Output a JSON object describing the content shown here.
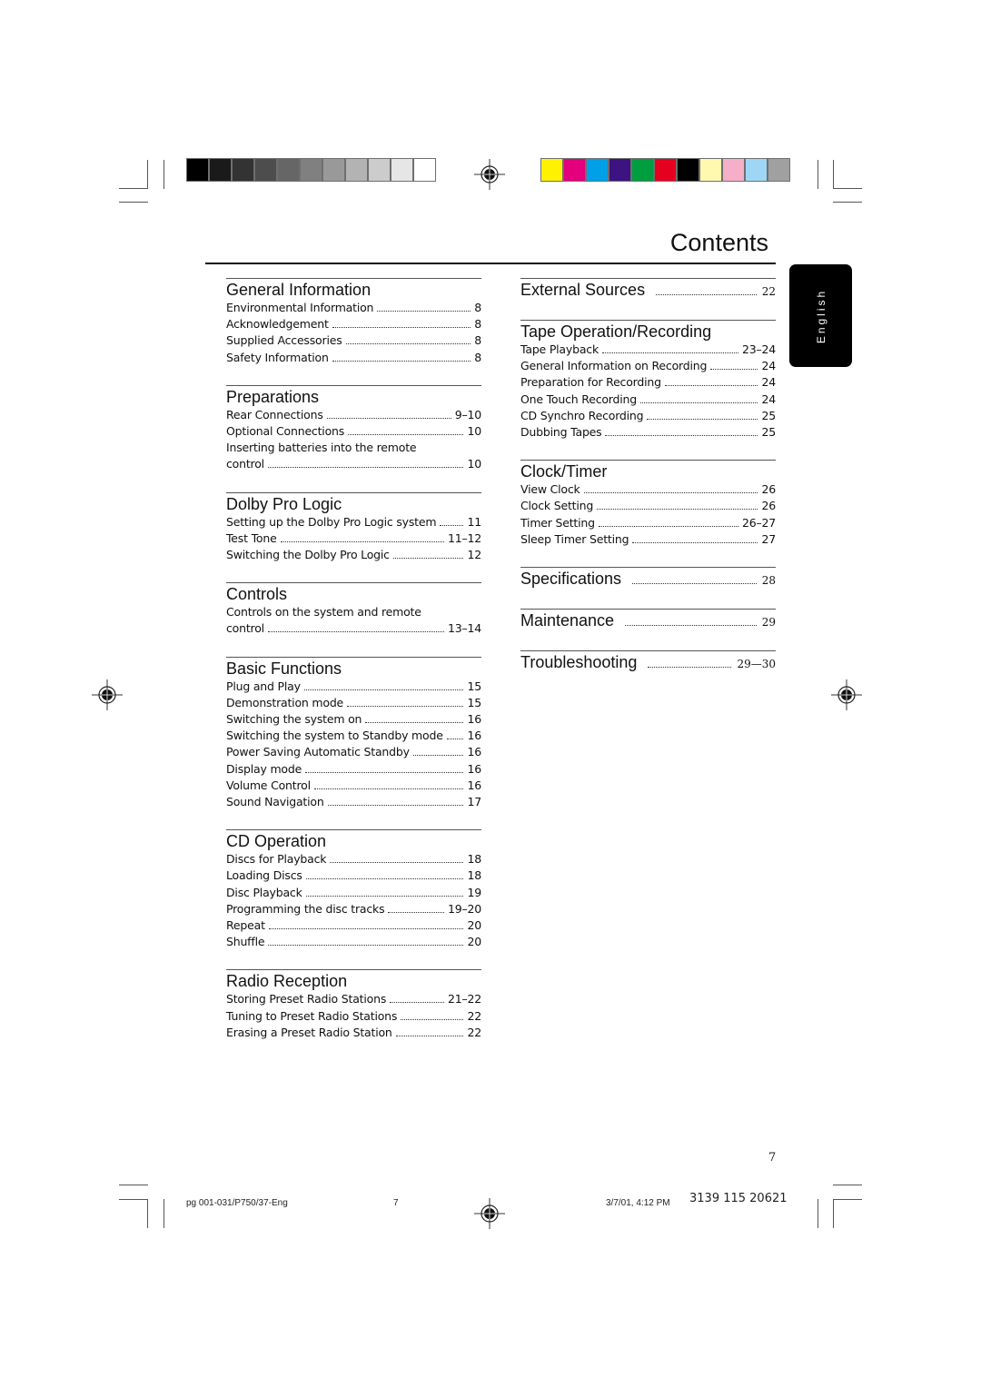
{
  "page": {
    "title": "Contents",
    "language_tab": "English",
    "page_number": "7"
  },
  "print_marks": {
    "grayscale_swatches": [
      "#000000",
      "#1a1a1a",
      "#333333",
      "#4d4d4d",
      "#666666",
      "#808080",
      "#999999",
      "#b3b3b3",
      "#cccccc",
      "#e6e6e6",
      "#ffffff"
    ],
    "color_swatches": [
      "#fff200",
      "#e4007c",
      "#00a0e9",
      "#3c1381",
      "#009e3f",
      "#e60020",
      "#000000",
      "#fff9b0",
      "#f5afc8",
      "#9fd6f6",
      "#a0a0a0"
    ]
  },
  "left_column": [
    {
      "heading": "General Information",
      "entries": [
        {
          "label": "Environmental Information",
          "page": "8"
        },
        {
          "label": "Acknowledgement",
          "page": "8"
        },
        {
          "label": "Supplied Accessories",
          "page": "8"
        },
        {
          "label": "Safety Information",
          "page": "8"
        }
      ]
    },
    {
      "heading": "Preparations",
      "entries": [
        {
          "label": "Rear Connections",
          "page": "9–10"
        },
        {
          "label": "Optional Connections",
          "page": "10"
        },
        {
          "label": "Inserting batteries into the remote",
          "label2": "control",
          "page": "10"
        }
      ]
    },
    {
      "heading": "Dolby Pro Logic",
      "entries": [
        {
          "label": "Setting up the Dolby Pro Logic system",
          "page": "11"
        },
        {
          "label": "Test Tone",
          "page": "11–12"
        },
        {
          "label": "Switching the Dolby Pro Logic",
          "page": "12"
        }
      ]
    },
    {
      "heading": "Controls",
      "entries": [
        {
          "label": "Controls on the system and remote",
          "label2": "control",
          "page": "13–14"
        }
      ]
    },
    {
      "heading": "Basic Functions",
      "entries": [
        {
          "label": "Plug and Play",
          "page": "15"
        },
        {
          "label": "Demonstration mode",
          "page": "15"
        },
        {
          "label": "Switching the system on",
          "page": "16"
        },
        {
          "label": "Switching the system to Standby mode",
          "page": "16"
        },
        {
          "label": "Power Saving Automatic Standby",
          "page": "16"
        },
        {
          "label": "Display mode",
          "page": "16"
        },
        {
          "label": "Volume Control",
          "page": "16"
        },
        {
          "label": "Sound Navigation",
          "page": "17"
        }
      ]
    },
    {
      "heading": "CD Operation",
      "entries": [
        {
          "label": "Discs for Playback",
          "page": "18"
        },
        {
          "label": "Loading Discs",
          "page": "18"
        },
        {
          "label": "Disc Playback",
          "page": "19"
        },
        {
          "label": "Programming the disc tracks",
          "page": "19–20"
        },
        {
          "label": "Repeat",
          "page": "20"
        },
        {
          "label": "Shuffle",
          "page": "20"
        }
      ]
    },
    {
      "heading": "Radio Reception",
      "entries": [
        {
          "label": "Storing Preset Radio Stations",
          "page": "21–22"
        },
        {
          "label": "Tuning to Preset Radio Stations",
          "page": "22"
        },
        {
          "label": "Erasing a Preset Radio Station",
          "page": "22"
        }
      ]
    }
  ],
  "right_column": [
    {
      "heading": "External Sources",
      "page": "22",
      "entries": []
    },
    {
      "heading": "Tape Operation/Recording",
      "entries": [
        {
          "label": "Tape Playback",
          "page": "23–24"
        },
        {
          "label": "General Information on Recording",
          "page": "24"
        },
        {
          "label": "Preparation for Recording",
          "page": "24"
        },
        {
          "label": "One Touch Recording",
          "page": "24"
        },
        {
          "label": "CD Synchro Recording",
          "page": "25"
        },
        {
          "label": "Dubbing Tapes",
          "page": "25"
        }
      ]
    },
    {
      "heading": "Clock/Timer",
      "entries": [
        {
          "label": "View Clock",
          "page": "26"
        },
        {
          "label": "Clock Setting",
          "page": "26"
        },
        {
          "label": "Timer Setting",
          "page": "26–27"
        },
        {
          "label": "Sleep Timer Setting",
          "page": "27"
        }
      ]
    },
    {
      "heading": "Specifications",
      "page": "28",
      "entries": []
    },
    {
      "heading": "Maintenance",
      "page": "29",
      "entries": []
    },
    {
      "heading": "Troubleshooting",
      "page": "29—30",
      "entries": []
    }
  ],
  "footer": {
    "file_name": "pg 001-031/P750/37-Eng",
    "sheet_number": "7",
    "timestamp": "3/7/01, 4:12 PM",
    "part_number": "3139 115 20621"
  }
}
